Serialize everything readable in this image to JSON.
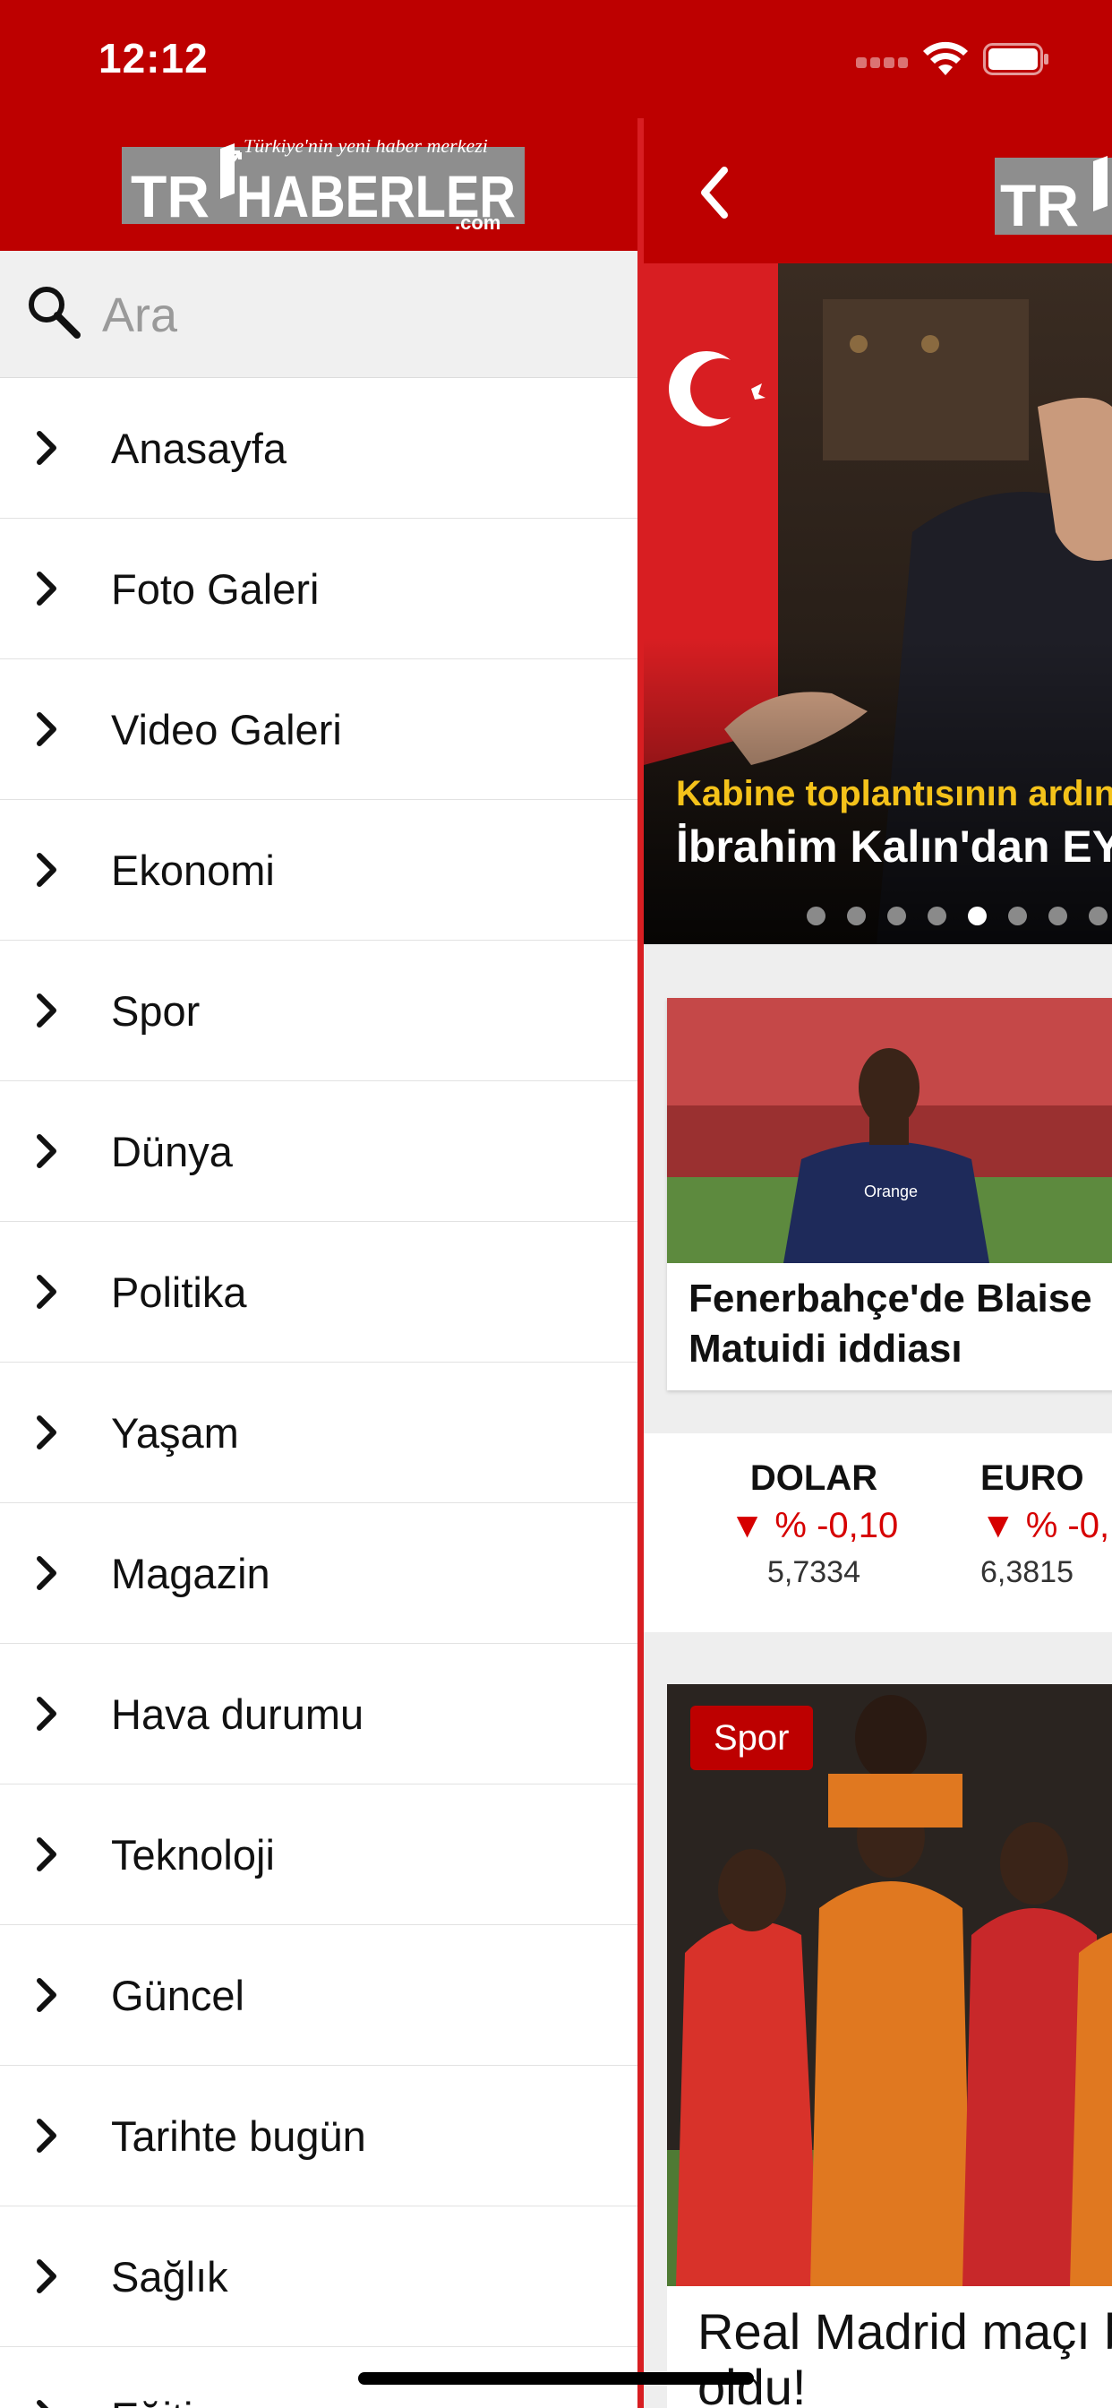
{
  "status_bar": {
    "time": "12:12"
  },
  "brand": {
    "tagline": "Türkiye'nin yeni haber merkezi",
    "logo_tr": "TR",
    "logo_name": "HABERLER",
    "logo_domain": ".com"
  },
  "search": {
    "placeholder": "Ara"
  },
  "menu": {
    "items": [
      {
        "label": "Anasayfa"
      },
      {
        "label": "Foto Galeri"
      },
      {
        "label": "Video Galeri"
      },
      {
        "label": "Ekonomi"
      },
      {
        "label": "Spor"
      },
      {
        "label": "Dünya"
      },
      {
        "label": "Politika"
      },
      {
        "label": "Yaşam"
      },
      {
        "label": "Magazin"
      },
      {
        "label": "Hava durumu"
      },
      {
        "label": "Teknoloji"
      },
      {
        "label": "Güncel"
      },
      {
        "label": "Tarihte bugün"
      },
      {
        "label": "Sağlık"
      },
      {
        "label": "Eğiti"
      }
    ]
  },
  "slider": {
    "kicker": "Kabine toplantısının ardın",
    "title": "İbrahim Kalın'dan EYT v",
    "dot_count": 8,
    "active_dot": 5
  },
  "card1": {
    "title": "Fenerbahçe'de Blaise Matuidi iddiası"
  },
  "currency": {
    "dolar": {
      "name": "DOLAR",
      "change": "% -0,10",
      "value": "5,7334"
    },
    "euro": {
      "name": "EURO",
      "change": "% -0,",
      "value": "6,3815"
    }
  },
  "card2": {
    "tag": "Spor",
    "title": "Real Madrid maçı belli oldu!"
  },
  "colors": {
    "brand_red": "#bd0000",
    "divider_red": "#d81e22",
    "kicker_yellow": "#f4c21a",
    "down_red": "#d60000"
  }
}
